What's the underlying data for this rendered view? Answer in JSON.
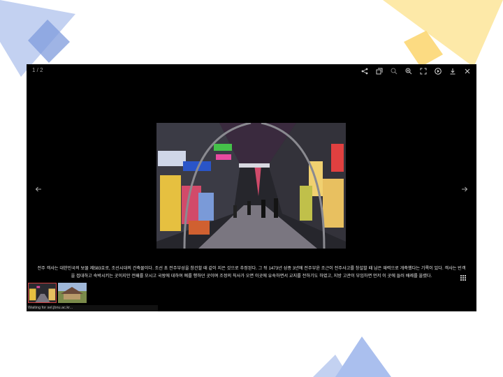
{
  "viewer": {
    "counter": "1 / 2",
    "toolbar": [
      {
        "name": "share-icon"
      },
      {
        "name": "slideshow-icon"
      },
      {
        "name": "zoom-out-icon"
      },
      {
        "name": "zoom-in-icon"
      },
      {
        "name": "fullscreen-icon"
      },
      {
        "name": "play-icon"
      },
      {
        "name": "download-icon"
      },
      {
        "name": "close-icon"
      }
    ],
    "caption": "전주 객사는 대한민국의 보물 제583호로, 조선시대의 건축물이다. 조선 초 전주부성을 창건할 때 같이 지은 것으로 추정된다. 그 뒤 1473년 성종 3년에 전주부윤 조근이 전주사고를 창설할 때 남은 재력으로 개축했다는 기록이 있다. 객사는 빈객을 접대하고 숙박시키는 곳이지만 전패를 모시고 국왕에 대하여 예를 행하던 곳이며 조정의 칙사가 오면 이곳에 유숙하면서 교지를 전하기도 하였고, 지방 고관이 부임하면 먼저 이 곳에 들러 배례를 올렸다.",
    "status": "Waiting for sel.jbnu.ac.kr..."
  },
  "colors": {
    "deco_blue": "#b8c8ec",
    "deco_blue_dark": "#6f8fd6",
    "deco_yellow": "#fde6a0",
    "deco_yellow_dark": "#fbd86f",
    "viewer_bg": "#000000"
  }
}
